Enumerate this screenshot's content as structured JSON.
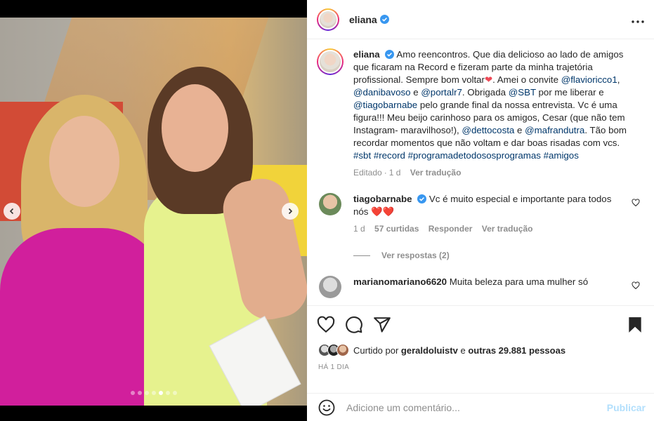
{
  "post": {
    "username": "eliana",
    "caption_parts": [
      {
        "t": "Amo reencontros. Que dia delicioso ao lado de amigos que ficaram na Record e fizeram parte da minha trajetória profissional. Sempre bom voltar",
        "link": false
      },
      {
        "t": "❤",
        "link": false,
        "heart": true
      },
      {
        "t": ". Amei o convite ",
        "link": false
      },
      {
        "t": "@flavioricco1",
        "link": true
      },
      {
        "t": ", ",
        "link": false
      },
      {
        "t": "@danibavoso",
        "link": true
      },
      {
        "t": " e ",
        "link": false
      },
      {
        "t": "@portalr7",
        "link": true
      },
      {
        "t": ". Obrigada ",
        "link": false
      },
      {
        "t": "@SBT",
        "link": true
      },
      {
        "t": " por me liberar e ",
        "link": false
      },
      {
        "t": "@tiagobarnabe",
        "link": true
      },
      {
        "t": " pelo grande final da nossa entrevista. Vc é uma figura!!! Meu beijo carinhoso para os amigos, Cesar (que não tem Instagram- maravilhoso!), ",
        "link": false
      },
      {
        "t": "@dettocosta",
        "link": true
      },
      {
        "t": " e ",
        "link": false
      },
      {
        "t": "@mafrandutra",
        "link": true
      },
      {
        "t": ". Tão bom recordar momentos que não voltam e dar boas risadas com vcs. ",
        "link": false
      },
      {
        "t": "#sbt",
        "link": true
      },
      {
        "t": " ",
        "link": false
      },
      {
        "t": "#record",
        "link": true
      },
      {
        "t": " ",
        "link": false
      },
      {
        "t": "#programadetodososprogramas",
        "link": true
      },
      {
        "t": " ",
        "link": false
      },
      {
        "t": "#amigos",
        "link": true
      }
    ],
    "caption_meta": {
      "edited": "Editado",
      "age": "1 d",
      "translate": "Ver tradução"
    }
  },
  "comments": [
    {
      "username": "tiagobarnabe",
      "verified": true,
      "text": "Vc é muito especial e importante para todos nós",
      "emoji": "❤️❤️",
      "age": "1 d",
      "likes": "57 curtidas",
      "reply": "Responder",
      "translate": "Ver tradução",
      "view_replies": "Ver respostas (2)"
    },
    {
      "username": "marianomariano6620",
      "verified": false,
      "text": "Muita beleza para uma mulher só"
    }
  ],
  "likes": {
    "prefix": "Curtido por ",
    "user": "geraldoluistv",
    "middle": " e ",
    "others": "outras 29.881 pessoas"
  },
  "timestamp": "HÁ 1 DIA",
  "add_comment": {
    "placeholder": "Adicione um comentário...",
    "publish": "Publicar"
  },
  "carousel": {
    "count": 7,
    "active_index": 4
  },
  "colors": {
    "link": "#00376b",
    "verified": "#3897f0",
    "heart": "#ed4956",
    "publish_disabled": "#b2dffc"
  },
  "icons": [
    "chevron-left-icon",
    "chevron-right-icon",
    "verified-badge-icon",
    "more-icon",
    "heart-icon",
    "comment-icon",
    "share-icon",
    "bookmark-icon",
    "emoji-icon"
  ]
}
